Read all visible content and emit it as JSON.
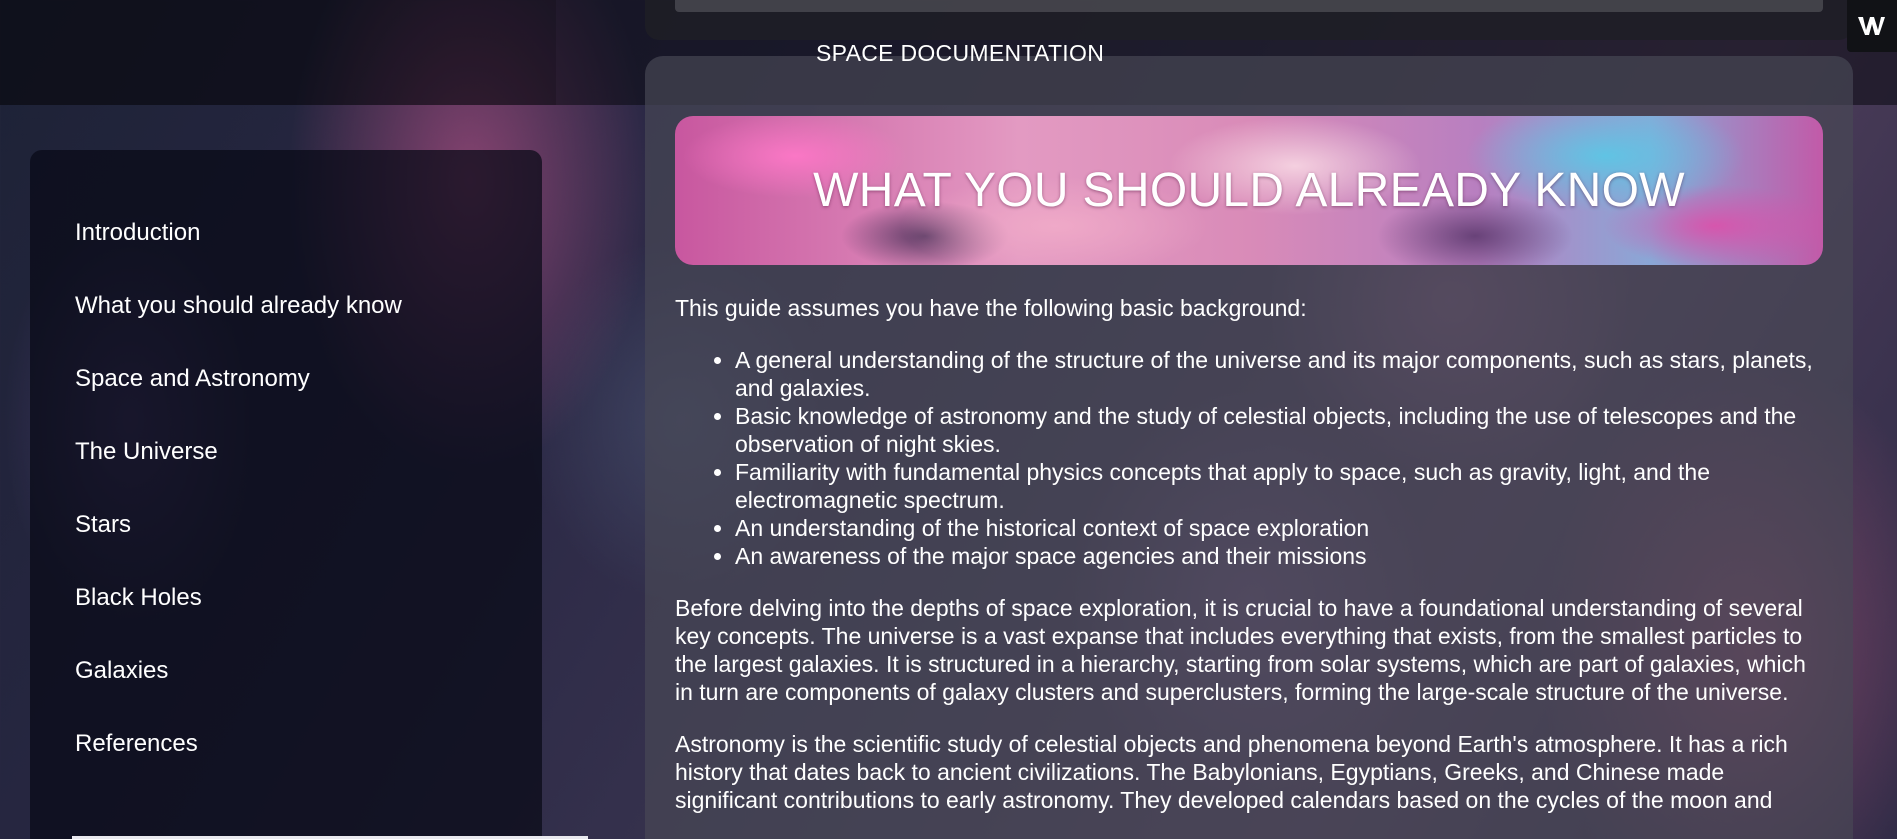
{
  "header": {
    "title": "SPACE DOCUMENTATION"
  },
  "logo": {
    "icon": "w-logo-icon"
  },
  "sidebar": {
    "items": [
      {
        "label": "Introduction"
      },
      {
        "label": "What you should already know"
      },
      {
        "label": "Space and Astronomy"
      },
      {
        "label": "The Universe"
      },
      {
        "label": "Stars"
      },
      {
        "label": "Black Holes"
      },
      {
        "label": "Galaxies"
      },
      {
        "label": "References"
      }
    ]
  },
  "main": {
    "banner_title": "WHAT YOU SHOULD ALREADY KNOW",
    "intro": "This guide assumes you have the following basic background:",
    "bullets": [
      "A general understanding of the structure of the universe and its major components, such as stars, planets, and galaxies.",
      "Basic knowledge of astronomy and the study of celestial objects, including the use of telescopes and the observation of night skies.",
      "Familiarity with fundamental physics concepts that apply to space, such as gravity, light, and the electromagnetic spectrum.",
      "An understanding of the historical context of space exploration",
      "An awareness of the major space agencies and their missions"
    ],
    "paragraph1": "Before delving into the depths of space exploration, it is crucial to have a foundational understanding of several key concepts. The universe is a vast expanse that includes everything that exists, from the smallest particles to the largest galaxies. It is structured in a hierarchy, starting from solar systems, which are part of galaxies, which in turn are components of galaxy clusters and superclusters, forming the large-scale structure of the universe.",
    "paragraph2": "Astronomy is the scientific study of celestial objects and phenomena beyond Earth's atmosphere. It has a rich history that dates back to ancient civilizations. The Babylonians, Egyptians, Greeks, and Chinese made significant contributions to early astronomy. They developed calendars based on the cycles of the moon and"
  }
}
